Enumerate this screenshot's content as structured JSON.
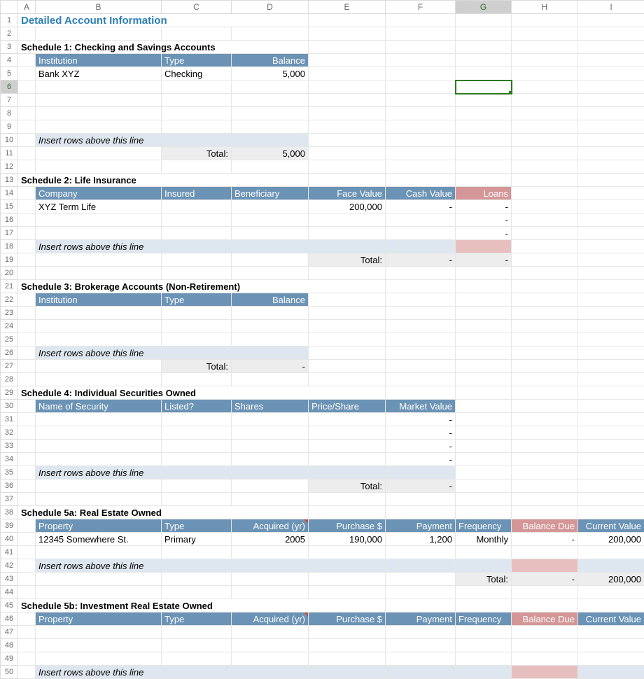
{
  "columns": [
    "A",
    "B",
    "C",
    "D",
    "E",
    "F",
    "G",
    "H",
    "I"
  ],
  "active_col": "G",
  "active_row": 6,
  "title": "Detailed Account Information",
  "sched1": {
    "heading": "Schedule 1: Checking and Savings Accounts",
    "headers": {
      "b": "Institution",
      "c": "Type",
      "d": "Balance"
    },
    "rows": [
      {
        "b": "Bank XYZ",
        "c": "Checking",
        "d": "5,000"
      }
    ],
    "insert": "Insert rows above this line",
    "total_label": "Total:",
    "total": "5,000"
  },
  "sched2": {
    "heading": "Schedule 2: Life Insurance",
    "headers": {
      "b": "Company",
      "c": "Insured",
      "d": "Beneficiary",
      "e": "Face Value",
      "f": "Cash Value",
      "g": "Loans"
    },
    "rows": [
      {
        "b": "XYZ Term Life",
        "e": "200,000",
        "f": "-",
        "g": "-"
      },
      {
        "g": "-"
      },
      {
        "g": "-"
      }
    ],
    "insert": "Insert rows above this line",
    "total_label": "Total:",
    "total_f": "-",
    "total_g": "-"
  },
  "sched3": {
    "heading": "Schedule 3: Brokerage Accounts (Non-Retirement)",
    "headers": {
      "b": "Institution",
      "c": "Type",
      "d": "Balance"
    },
    "insert": "Insert rows above this line",
    "total_label": "Total:",
    "total": "-"
  },
  "sched4": {
    "heading": "Schedule 4: Individual Securities Owned",
    "headers": {
      "b": "Name of Security",
      "c": "Listed?",
      "d": "Shares",
      "e": "Price/Share",
      "f": "Market Value"
    },
    "rows": [
      {
        "f": "-"
      },
      {
        "f": "-"
      },
      {
        "f": "-"
      },
      {
        "f": "-"
      }
    ],
    "insert": "Insert rows above this line",
    "total_label": "Total:",
    "total": "-"
  },
  "sched5a": {
    "heading": "Schedule 5a: Real Estate Owned",
    "headers": {
      "b": "Property",
      "c": "Type",
      "d": "Acquired (yr)",
      "e": "Purchase $",
      "f": "Payment",
      "g": "Frequency",
      "h": "Balance Due",
      "i": "Current Value"
    },
    "rows": [
      {
        "b": "12345 Somewhere St.",
        "c": "Primary",
        "d": "2005",
        "e": "190,000",
        "f": "1,200",
        "g": "Monthly",
        "h": "-",
        "i": "200,000"
      }
    ],
    "insert": "Insert rows above this line",
    "total_label": "Total:",
    "total_h": "-",
    "total_i": "200,000"
  },
  "sched5b": {
    "heading": "Schedule 5b: Investment Real Estate Owned",
    "headers": {
      "b": "Property",
      "c": "Type",
      "d": "Acquired (yr)",
      "e": "Purchase $",
      "f": "Payment",
      "g": "Frequency",
      "h": "Balance Due",
      "i": "Current Value"
    },
    "insert": "Insert rows above this line"
  }
}
